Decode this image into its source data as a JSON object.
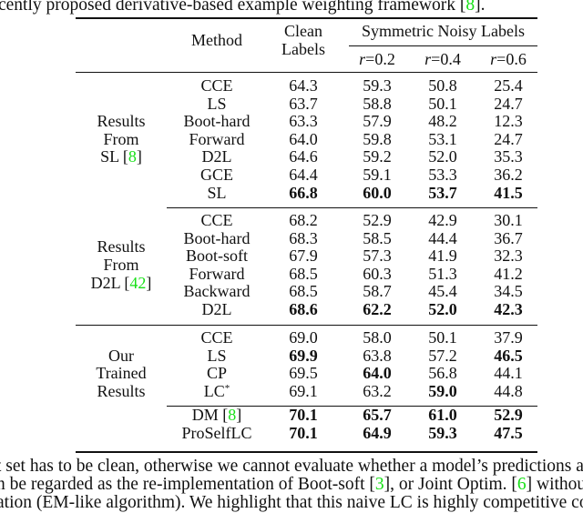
{
  "top_text": {
    "before": "cently proposed derivative-based example weighting framework [",
    "cite": "8",
    "after": "]."
  },
  "table": {
    "headers": {
      "method": "Method",
      "clean_line1": "Clean",
      "clean_line2": "Labels",
      "noisy_group": "Symmetric Noisy Labels",
      "r_var": "r",
      "r_values": [
        "=0.2",
        "=0.4",
        "=0.6"
      ]
    },
    "groups": [
      {
        "label_lines": [
          "Results",
          "From",
          "SL ["
        ],
        "label_cite": "8",
        "label_cite_close": "]",
        "rows": [
          {
            "method": "CCE",
            "values": [
              "64.3",
              "59.3",
              "50.8",
              "25.4"
            ],
            "bold": [
              false,
              false,
              false,
              false
            ]
          },
          {
            "method": "LS",
            "values": [
              "63.7",
              "58.8",
              "50.1",
              "24.7"
            ],
            "bold": [
              false,
              false,
              false,
              false
            ]
          },
          {
            "method": "Boot-hard",
            "values": [
              "63.3",
              "57.9",
              "48.2",
              "12.3"
            ],
            "bold": [
              false,
              false,
              false,
              false
            ]
          },
          {
            "method": "Forward",
            "values": [
              "64.0",
              "59.8",
              "53.1",
              "24.7"
            ],
            "bold": [
              false,
              false,
              false,
              false
            ]
          },
          {
            "method": "D2L",
            "values": [
              "64.6",
              "59.2",
              "52.0",
              "35.3"
            ],
            "bold": [
              false,
              false,
              false,
              false
            ]
          },
          {
            "method": "GCE",
            "values": [
              "64.4",
              "59.1",
              "53.3",
              "36.2"
            ],
            "bold": [
              false,
              false,
              false,
              false
            ]
          },
          {
            "method": "SL",
            "values": [
              "66.8",
              "60.0",
              "53.7",
              "41.5"
            ],
            "bold": [
              true,
              true,
              true,
              true
            ]
          }
        ]
      },
      {
        "label_lines": [
          "Results",
          "From",
          "D2L ["
        ],
        "label_cite": "42",
        "label_cite_close": "]",
        "rows": [
          {
            "method": "CCE",
            "values": [
              "68.2",
              "52.9",
              "42.9",
              "30.1"
            ],
            "bold": [
              false,
              false,
              false,
              false
            ]
          },
          {
            "method": "Boot-hard",
            "values": [
              "68.3",
              "58.5",
              "44.4",
              "36.7"
            ],
            "bold": [
              false,
              false,
              false,
              false
            ]
          },
          {
            "method": "Boot-soft",
            "values": [
              "67.9",
              "57.3",
              "41.9",
              "32.3"
            ],
            "bold": [
              false,
              false,
              false,
              false
            ]
          },
          {
            "method": "Forward",
            "values": [
              "68.5",
              "60.3",
              "51.3",
              "41.2"
            ],
            "bold": [
              false,
              false,
              false,
              false
            ]
          },
          {
            "method": "Backward",
            "values": [
              "68.5",
              "58.7",
              "45.4",
              "34.5"
            ],
            "bold": [
              false,
              false,
              false,
              false
            ]
          },
          {
            "method": "D2L",
            "values": [
              "68.6",
              "62.2",
              "52.0",
              "42.3"
            ],
            "bold": [
              true,
              true,
              true,
              true
            ]
          }
        ]
      },
      {
        "label_lines": [
          "Our",
          "Trained",
          "Results"
        ],
        "rows": [
          {
            "method": "CCE",
            "values": [
              "69.0",
              "58.0",
              "50.1",
              "37.9"
            ],
            "bold": [
              false,
              false,
              false,
              false
            ]
          },
          {
            "method": "LS",
            "values": [
              "69.9",
              "63.8",
              "57.2",
              "46.5"
            ],
            "bold": [
              true,
              false,
              false,
              true
            ]
          },
          {
            "method": "CP",
            "values": [
              "69.5",
              "64.0",
              "56.8",
              "44.1"
            ],
            "bold": [
              false,
              true,
              false,
              false
            ]
          },
          {
            "method": "LC",
            "method_sup": "*",
            "values": [
              "69.1",
              "63.2",
              "59.0",
              "44.8"
            ],
            "bold": [
              false,
              false,
              true,
              false
            ]
          }
        ],
        "extra_rows": [
          {
            "method": "DM [",
            "method_cite": "8",
            "method_close": "]",
            "values": [
              "70.1",
              "65.7",
              "61.0",
              "52.9"
            ],
            "bold": [
              true,
              true,
              true,
              true
            ]
          },
          {
            "method": "ProSelfLC",
            "values": [
              "70.1",
              "64.9",
              "59.3",
              "47.5"
            ],
            "bold": [
              true,
              true,
              true,
              true
            ]
          }
        ]
      }
    ]
  },
  "bottom_text": {
    "line1": "t set has to be clean, otherwise we cannot evaluate whether a model’s predictions a",
    "line2_before": "n be regarded as the re-implementation of Boot-soft [",
    "line2_cite1": "3",
    "line2_mid": "], or Joint Optim. [",
    "line2_cite2": "6",
    "line2_after": "] without",
    "line3": "ation (EM-like algorithm). We highlight that this naive LC is highly competitive co"
  },
  "colors": {
    "citation": "#18e018",
    "text": "#111111"
  }
}
